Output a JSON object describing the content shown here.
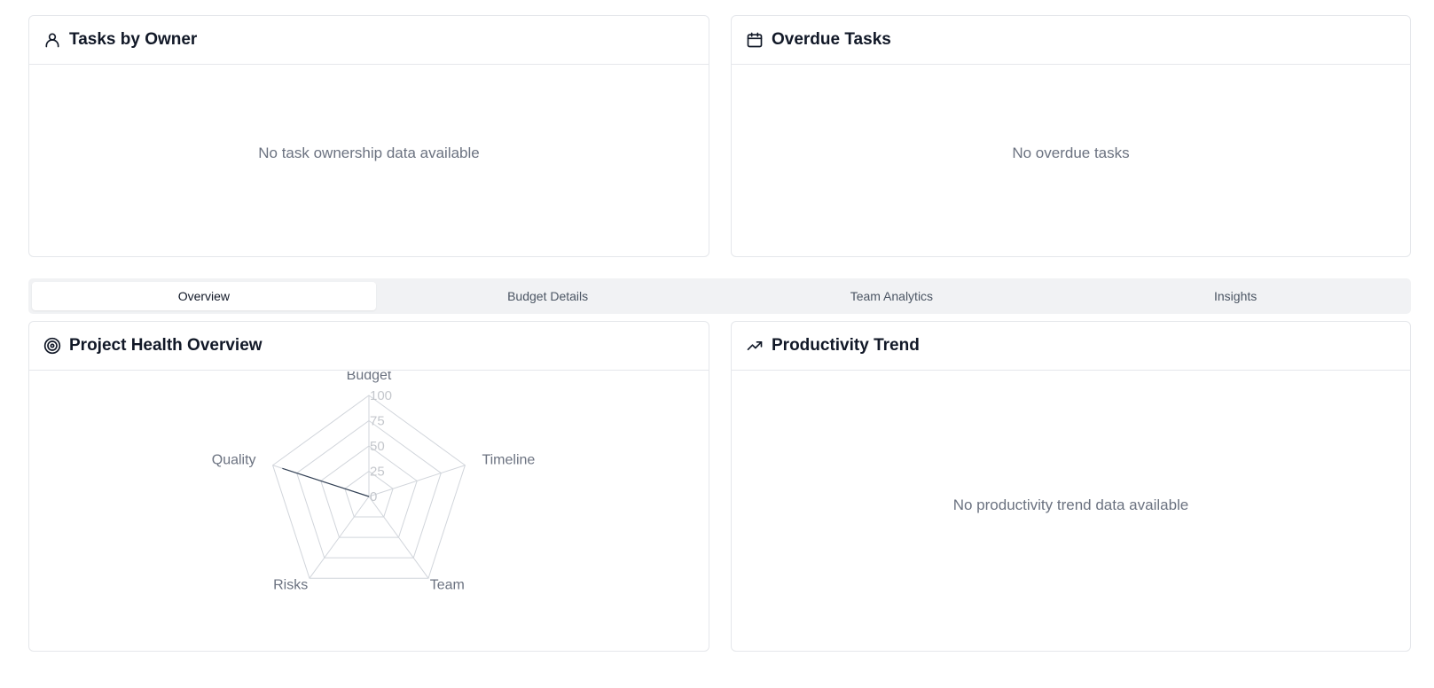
{
  "tasks_by_owner": {
    "title": "Tasks by Owner",
    "icon": "user-icon",
    "empty_message": "No task ownership data available"
  },
  "overdue_tasks": {
    "title": "Overdue Tasks",
    "icon": "calendar-icon",
    "empty_message": "No overdue tasks"
  },
  "tabs": [
    {
      "label": "Overview",
      "active": true
    },
    {
      "label": "Budget Details",
      "active": false
    },
    {
      "label": "Team Analytics",
      "active": false
    },
    {
      "label": "Insights",
      "active": false
    }
  ],
  "project_health": {
    "title": "Project Health Overview",
    "icon": "target-icon"
  },
  "productivity_trend": {
    "title": "Productivity Trend",
    "icon": "trending-up-icon",
    "empty_message": "No productivity trend data available"
  },
  "chart_data": {
    "type": "radar",
    "categories": [
      "Budget",
      "Timeline",
      "Team",
      "Risks",
      "Quality"
    ],
    "values": [
      0,
      0,
      0,
      0,
      90
    ],
    "ticks": [
      "0",
      "25",
      "50",
      "75",
      "100"
    ],
    "range": [
      0,
      100
    ],
    "grid": true
  },
  "colors": {
    "border": "#e5e7eb",
    "tab_bar": "#f1f2f4",
    "muted_text": "#6b7280",
    "series_stroke": "#334155",
    "grid": "#d1d5db"
  }
}
